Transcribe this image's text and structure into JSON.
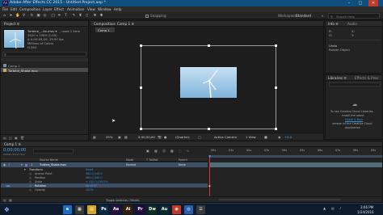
{
  "window": {
    "title": "Adobe After Effects CC 2015 - Untitled Project.aep *"
  },
  "menu": [
    "File",
    "Edit",
    "Composition",
    "Layer",
    "Effect",
    "Animation",
    "View",
    "Window",
    "Help"
  ],
  "toolbar": {
    "snapping": "Snapping",
    "workspace_label": "Workspace:",
    "workspace_value": "Standard",
    "search_placeholder": "Search Help"
  },
  "project_panel": {
    "tab": "Project ≡",
    "selected_name": "Turbine_...ke.mov ▾",
    "used": ", used 1 time",
    "dims": "1920 x 1080 (1.00)",
    "duration": "Δ 0;00;09;29, 29.97 fps",
    "colors": "Millions of Colors",
    "codec": "H.264",
    "items": [
      "Comp 1",
      "Turbine_Shake.mov"
    ]
  },
  "comp_panel": {
    "tab": "Composition: Comp 1 ≡",
    "subtab": "Comp 1",
    "zoom": "25%",
    "timecode": "0;00;00;00",
    "quality": "(Quarter)",
    "camera": "Active Camera",
    "views": "1 View",
    "exposure": "+0.0"
  },
  "info_panel": {
    "tab_info": "Info ≡",
    "tab_audio": "Audio",
    "undo": "Undo",
    "undo_action": "Rotate Object"
  },
  "libraries_panel": {
    "tab": "Libraries ≡",
    "tab2": "Effects & Pres",
    "message": [
      "To use Creative Cloud Libraries,",
      "install the latest",
      "version of the Creative Cloud",
      "Application"
    ],
    "link": "Install it Now"
  },
  "timeline": {
    "tab": "Comp 1 ≡",
    "timecode": "0;00;00;00",
    "fps": "00000 (29.97 fps)",
    "col_source": "Source Name",
    "col_mode": "Mode",
    "col_trkmat": "T TrkMat",
    "col_parent": "Parent",
    "layer_num": "1",
    "layer_name": "Turbine_Shake.mov",
    "layer_mode": "Normal",
    "layer_parent": "None",
    "transform": "Transform",
    "reset": "Reset",
    "props": [
      {
        "name": "Anchor Point",
        "value": "960.0,540.0"
      },
      {
        "name": "Position",
        "value": "960.0,540.0"
      },
      {
        "name": "Scale",
        "value": "∞ 100.0,100.0%"
      },
      {
        "name": "Rotation",
        "value": "0x+0.0°"
      },
      {
        "name": "Opacity",
        "value": "100%"
      }
    ],
    "ruler": [
      "00s",
      "01s",
      "02s",
      "03s",
      "04s",
      "05s",
      "06s",
      "07s",
      "08s",
      "09s"
    ],
    "footer": "Toggle Switches / Modes"
  },
  "taskbar": {
    "time": "3:06 PM",
    "date": "1/24/2016",
    "apps": [
      {
        "label": "e",
        "color": "#1a70c8"
      },
      {
        "label": "▦",
        "color": "#3a3a3a"
      },
      {
        "label": "▤",
        "color": "#d9a520"
      },
      {
        "label": "Ps",
        "color": "#0a2b44"
      },
      {
        "label": "Ae",
        "color": "#2a0f40"
      },
      {
        "label": "Ai",
        "color": "#3b1c04"
      },
      {
        "label": "Pr",
        "color": "#230a3a"
      },
      {
        "label": "Dw",
        "color": "#0b2e1e"
      },
      {
        "label": "Au",
        "color": "#0a2b2e"
      },
      {
        "label": "◉",
        "color": "#c33a2a"
      },
      {
        "label": "◎",
        "color": "#2a5fb0"
      },
      {
        "label": "☰",
        "color": "#3a3a3a"
      }
    ]
  }
}
